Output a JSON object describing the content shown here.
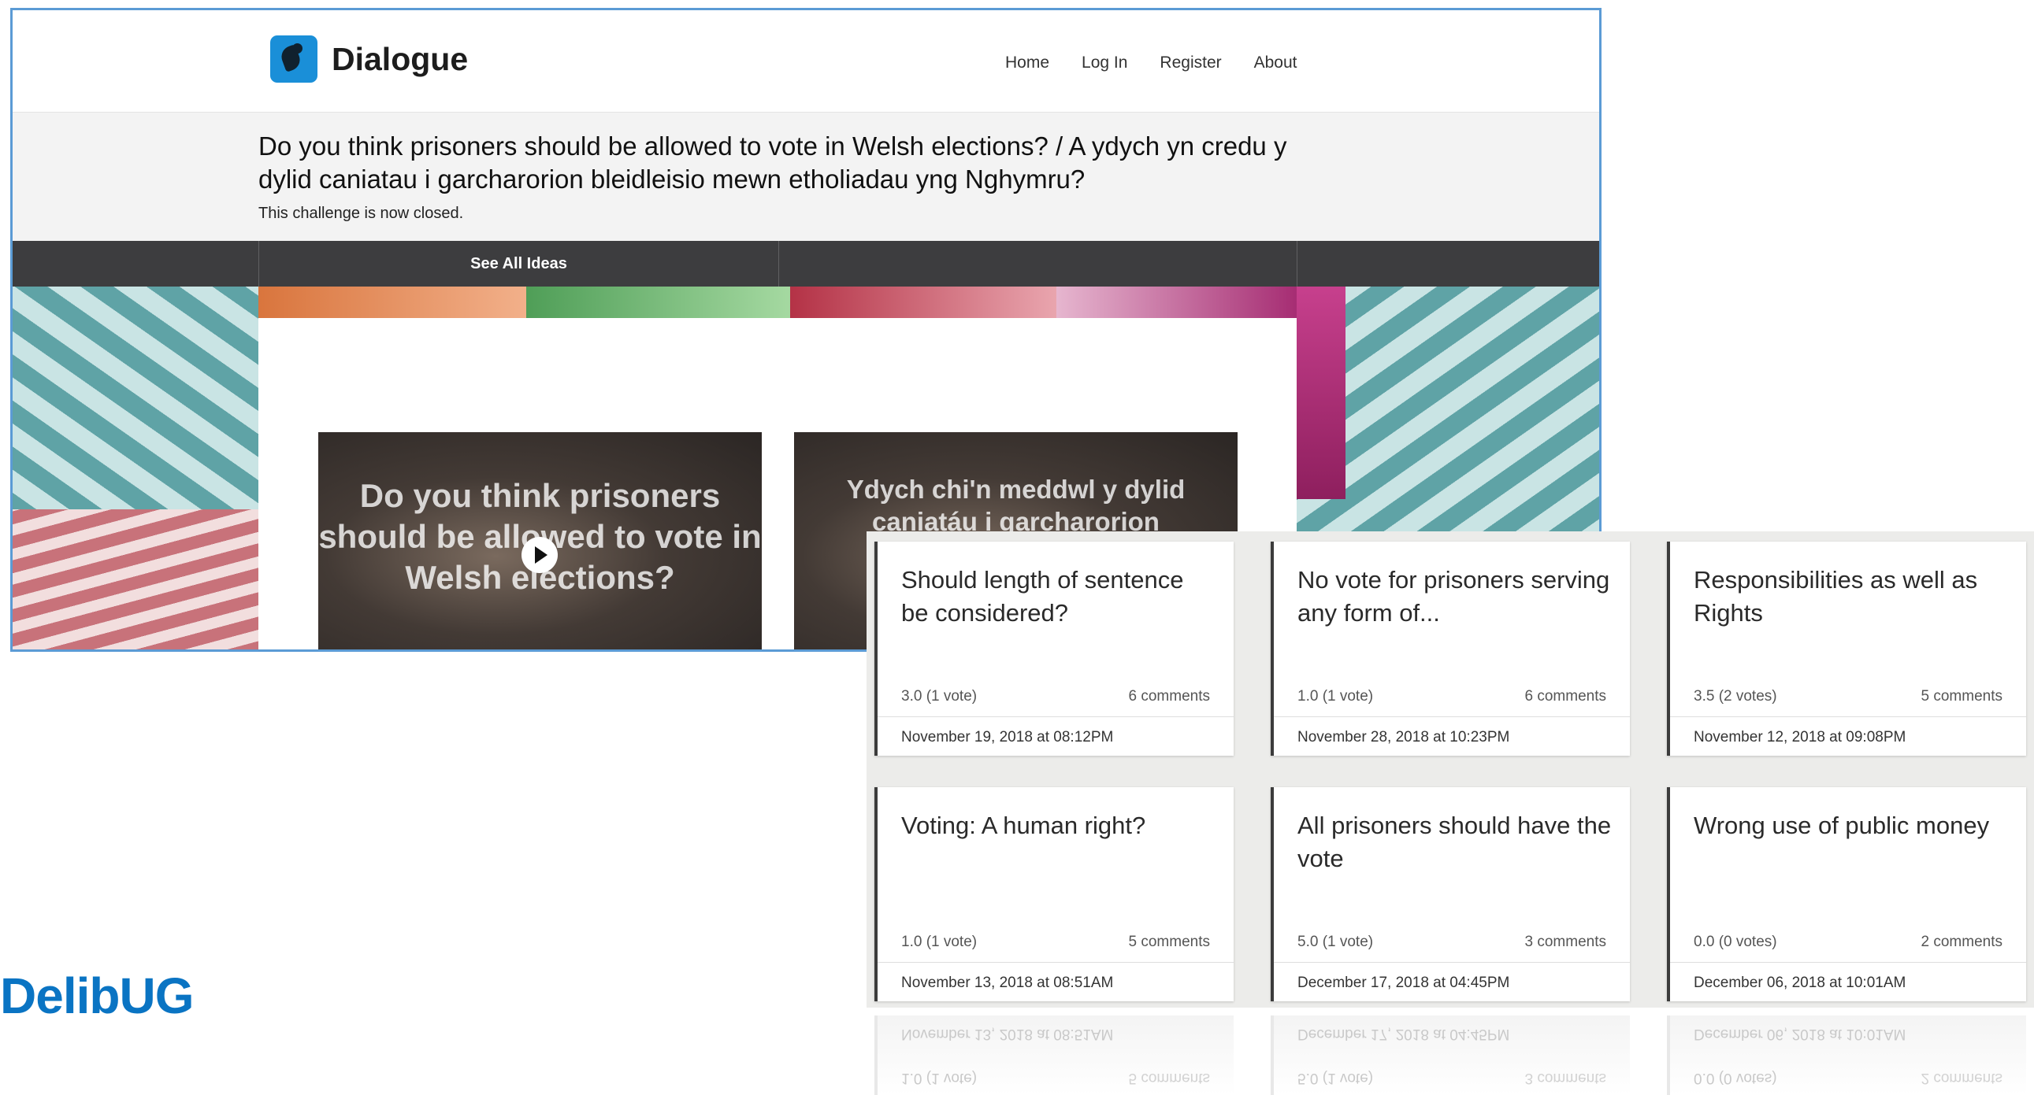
{
  "app": {
    "name": "Dialogue",
    "nav": [
      "Home",
      "Log In",
      "Register",
      "About"
    ]
  },
  "challenge": {
    "title": "Do you think prisoners should be allowed to vote in Welsh elections? / A ydych yn credu y dylid caniatau i garcharorion bleidleisio mewn etholiadau yng Nghymru?",
    "status": "This challenge is now closed."
  },
  "tabs": {
    "see_all_ideas": "See All Ideas"
  },
  "videos": [
    {
      "caption": "Do you think prisoners should be allowed to vote in Welsh elections?"
    },
    {
      "caption": "Ydych chi'n meddwl y dylid caniatáu i garcharorion"
    }
  ],
  "ideas": [
    {
      "title": "Should length of sentence be considered?",
      "rating": "3.0 (1 vote)",
      "comments": "6 comments",
      "date": "November 19, 2018 at 08:12PM"
    },
    {
      "title": "No vote for prisoners serving any form of...",
      "rating": "1.0 (1 vote)",
      "comments": "6 comments",
      "date": "November 28, 2018 at 10:23PM"
    },
    {
      "title": "Responsibilities as well as Rights",
      "rating": "3.5 (2 votes)",
      "comments": "5 comments",
      "date": "November 12, 2018 at 09:08PM"
    },
    {
      "title": "Voting: A human right?",
      "rating": "1.0 (1 vote)",
      "comments": "5 comments",
      "date": "November 13, 2018 at 08:51AM"
    },
    {
      "title": "All prisoners should have the vote",
      "rating": "5.0 (1 vote)",
      "comments": "3 comments",
      "date": "December 17, 2018 at 04:45PM"
    },
    {
      "title": "Wrong use of public money",
      "rating": "0.0 (0 votes)",
      "comments": "2 comments",
      "date": "December 06, 2018 at 10:01AM"
    }
  ],
  "footer_brand": "DelibUG",
  "colors": {
    "accent": "#1a8fd8",
    "tabbar": "#3d3d3f",
    "brand": "#0a74c3",
    "frame": "#5b9bd5"
  }
}
